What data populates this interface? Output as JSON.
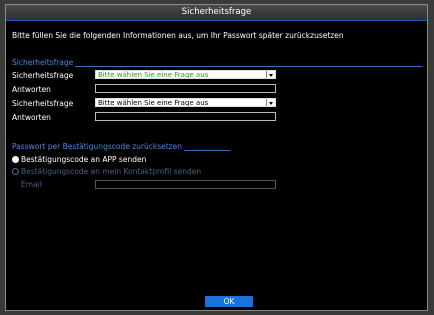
{
  "window": {
    "title": "Sicherheitsfrage"
  },
  "info_text": "Bitte füllen Sie die folgenden Informationen aus, um Ihr Passwort später zurückzusetzen",
  "security_section": {
    "title": "Sicherheitsfrage",
    "rows": [
      {
        "label": "Sicherheitsfrage",
        "value": "Bitte wählen Sie eine Frage aus"
      },
      {
        "label": "Antworten",
        "value": ""
      },
      {
        "label": "Sicherheitsfrage",
        "value": "Bitte wählen Sie eine Frage aus"
      },
      {
        "label": "Antworten",
        "value": ""
      }
    ]
  },
  "reset_section": {
    "title": "Passwort per Bestätigungscode zurücksetzen",
    "options": [
      {
        "label": "Bestätigungscode an APP senden",
        "selected": true
      },
      {
        "label": "Bestätigungscode an mein Kontaktprofil senden",
        "selected": false
      }
    ],
    "email_label": "Email",
    "email_value": ""
  },
  "buttons": {
    "ok": "OK"
  },
  "colors": {
    "accent": "#1a73d8",
    "section_text": "#4a8ad8",
    "select_green_text": "#2a9a2a"
  }
}
